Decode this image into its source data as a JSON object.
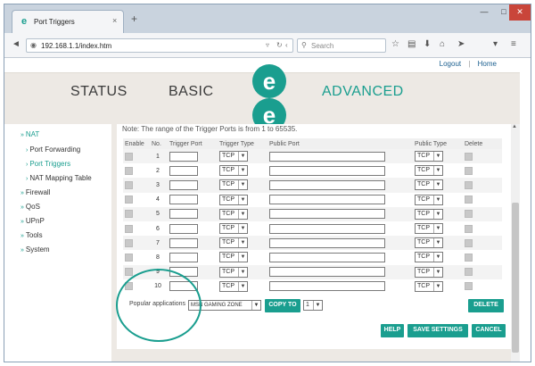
{
  "browser": {
    "tab_logo": "e",
    "tab_title": "Port Triggers",
    "tab_close": "×",
    "new_tab": "+",
    "win_min": "—",
    "win_max": "□",
    "win_close": "✕",
    "url": "192.168.1.1/index.htm",
    "search_placeholder": "Search"
  },
  "toplinks": {
    "logout": "Logout",
    "sep": "|",
    "home": "Home"
  },
  "nav": {
    "status": "STATUS",
    "basic": "BASIC",
    "advanced": "ADVANCED",
    "logo_letter": "e"
  },
  "sidebar": {
    "items": [
      {
        "label": "NAT",
        "indent": false,
        "active": true
      },
      {
        "label": "Port Forwarding",
        "indent": true,
        "active": false
      },
      {
        "label": "Port Triggers",
        "indent": true,
        "active": true
      },
      {
        "label": "NAT Mapping Table",
        "indent": true,
        "active": false
      },
      {
        "label": "Firewall",
        "indent": false,
        "active": false
      },
      {
        "label": "QoS",
        "indent": false,
        "active": false
      },
      {
        "label": "UPnP",
        "indent": false,
        "active": false
      },
      {
        "label": "Tools",
        "indent": false,
        "active": false
      },
      {
        "label": "System",
        "indent": false,
        "active": false
      }
    ]
  },
  "main": {
    "note": "Note: The range of the Trigger Ports is from 1 to 65535.",
    "columns": {
      "enable": "Enable",
      "no": "No.",
      "trigger_port": "Trigger Port",
      "trigger_type": "Trigger Type",
      "public_port": "Public Port",
      "public_type": "Public Type",
      "delete": "Delete"
    },
    "rows": [
      {
        "no": "1",
        "trigger_type": "TCP",
        "public_type": "TCP"
      },
      {
        "no": "2",
        "trigger_type": "TCP",
        "public_type": "TCP"
      },
      {
        "no": "3",
        "trigger_type": "TCP",
        "public_type": "TCP"
      },
      {
        "no": "4",
        "trigger_type": "TCP",
        "public_type": "TCP"
      },
      {
        "no": "5",
        "trigger_type": "TCP",
        "public_type": "TCP"
      },
      {
        "no": "6",
        "trigger_type": "TCP",
        "public_type": "TCP"
      },
      {
        "no": "7",
        "trigger_type": "TCP",
        "public_type": "TCP"
      },
      {
        "no": "8",
        "trigger_type": "TCP",
        "public_type": "TCP"
      },
      {
        "no": "9",
        "trigger_type": "TCP",
        "public_type": "TCP"
      },
      {
        "no": "10",
        "trigger_type": "TCP",
        "public_type": "TCP"
      }
    ],
    "popular_label": "Popular applications",
    "popular_value": "MSN GAMING ZONE",
    "copy_to_label": "COPY TO",
    "copy_to_value": "1",
    "delete_label": "DELETE",
    "help_label": "HELP",
    "save_label": "SAVE SETTINGS",
    "cancel_label": "CANCEL"
  },
  "colors": {
    "accent": "#1a9e8f",
    "header_bg": "#ede9e4"
  }
}
